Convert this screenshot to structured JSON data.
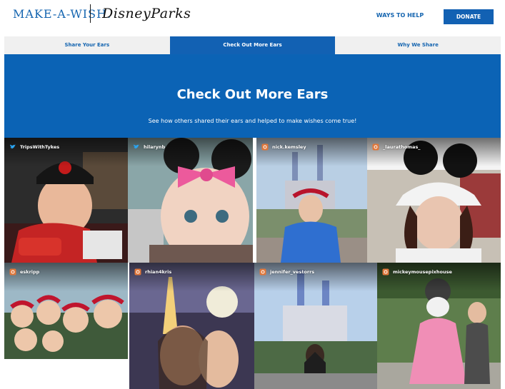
{
  "header": {
    "logo_make_a_wish": "MAKE-A-WISH.",
    "logo_disney_parks": "DisneyParks",
    "ways_to_help": "WAYS TO HELP",
    "donate": "DONATE"
  },
  "tabs": [
    {
      "label": "Share Your Ears",
      "active": false
    },
    {
      "label": "Check Out More Ears",
      "active": true
    },
    {
      "label": "Why We Share",
      "active": false
    }
  ],
  "hero": {
    "title": "Check Out More Ears",
    "subtitle": "See how others shared their ears and helped to make wishes come true!"
  },
  "posts": [
    {
      "username": "TripsWithTykes",
      "network": "twitter-icon"
    },
    {
      "username": "hilarynb",
      "network": "twitter-icon"
    },
    {
      "username": "nick.kemsley",
      "network": "instagram-icon"
    },
    {
      "username": "_laurathomas_",
      "network": "instagram-icon"
    },
    {
      "username": "eskripp",
      "network": "instagram-icon"
    },
    {
      "username": "rhian4kris",
      "network": "instagram-icon"
    },
    {
      "username": "jennifer_vestorrs",
      "network": "instagram-icon"
    },
    {
      "username": "mickeymousepixhouse",
      "network": "instagram-icon"
    }
  ],
  "colors": {
    "brand_blue": "#1261b3",
    "hero_blue": "#0b63b5",
    "twitter_blue": "#2aa3ef",
    "instagram_orange": "#e0773a"
  }
}
